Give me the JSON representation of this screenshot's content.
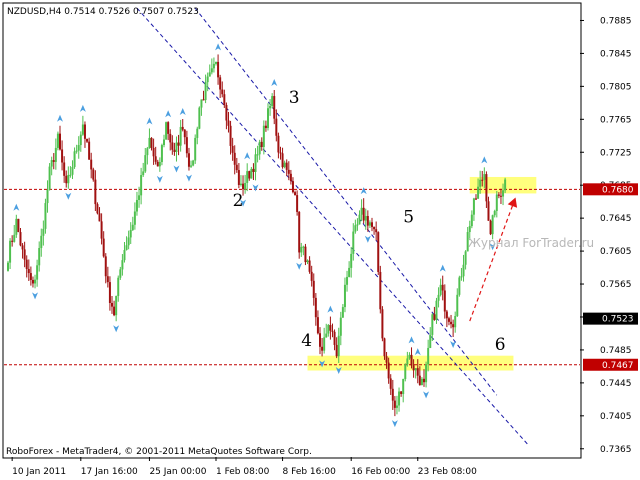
{
  "chart_data": {
    "type": "candlestick",
    "title": "NZDUSD,H4  0.7514 0.7526 0.7507 0.7523",
    "symbol": "NZDUSD,H4",
    "ohlc_readout": [
      "0.7514",
      "0.7526",
      "0.7507",
      "0.7523"
    ],
    "credit": "RoboForex - MetaTrader4, © 2001-2011 MetaQuotes Software Corp.",
    "watermark": "Журнал ForTrader.ru",
    "ylim": [
      0.7355,
      0.7905
    ],
    "y_ticks": [
      "0.7885",
      "0.7845",
      "0.7805",
      "0.7765",
      "0.7725",
      "0.7685",
      "0.7645",
      "0.7605",
      "0.7565",
      "0.7525",
      "0.7485",
      "0.7445",
      "0.7405",
      "0.7365"
    ],
    "x_ticks": [
      {
        "label": "10 Jan 2011",
        "bar": 2
      },
      {
        "label": "17 Jan 16:00",
        "bar": 35
      },
      {
        "label": "25 Jan 00:00",
        "bar": 68
      },
      {
        "label": "1 Feb 08:00",
        "bar": 100
      },
      {
        "label": "8 Feb 16:00",
        "bar": 132
      },
      {
        "label": "16 Feb 00:00",
        "bar": 165
      },
      {
        "label": "23 Feb 08:00",
        "bar": 197
      }
    ],
    "bar_count": 240,
    "anchors": [
      {
        "bar": 0,
        "price": 0.76
      },
      {
        "bar": 4,
        "price": 0.764
      },
      {
        "bar": 8,
        "price": 0.759
      },
      {
        "bar": 12,
        "price": 0.756
      },
      {
        "bar": 16,
        "price": 0.762
      },
      {
        "bar": 20,
        "price": 0.77
      },
      {
        "bar": 24,
        "price": 0.774
      },
      {
        "bar": 28,
        "price": 0.768
      },
      {
        "bar": 32,
        "price": 0.772
      },
      {
        "bar": 36,
        "price": 0.776
      },
      {
        "bar": 40,
        "price": 0.77
      },
      {
        "bar": 44,
        "price": 0.764
      },
      {
        "bar": 48,
        "price": 0.756
      },
      {
        "bar": 51,
        "price": 0.753
      },
      {
        "bar": 55,
        "price": 0.76
      },
      {
        "bar": 60,
        "price": 0.764
      },
      {
        "bar": 64,
        "price": 0.769
      },
      {
        "bar": 68,
        "price": 0.774
      },
      {
        "bar": 72,
        "price": 0.77
      },
      {
        "bar": 76,
        "price": 0.776
      },
      {
        "bar": 80,
        "price": 0.772
      },
      {
        "bar": 84,
        "price": 0.776
      },
      {
        "bar": 88,
        "price": 0.77
      },
      {
        "bar": 92,
        "price": 0.778
      },
      {
        "bar": 96,
        "price": 0.781
      },
      {
        "bar": 100,
        "price": 0.783
      },
      {
        "bar": 104,
        "price": 0.779
      },
      {
        "bar": 108,
        "price": 0.772
      },
      {
        "bar": 112,
        "price": 0.768
      },
      {
        "bar": 116,
        "price": 0.77
      },
      {
        "bar": 120,
        "price": 0.772
      },
      {
        "bar": 124,
        "price": 0.776
      },
      {
        "bar": 127,
        "price": 0.779
      },
      {
        "bar": 130,
        "price": 0.773
      },
      {
        "bar": 134,
        "price": 0.77
      },
      {
        "bar": 138,
        "price": 0.768
      },
      {
        "bar": 140,
        "price": 0.761
      },
      {
        "bar": 143,
        "price": 0.76
      },
      {
        "bar": 146,
        "price": 0.756
      },
      {
        "bar": 148,
        "price": 0.752
      },
      {
        "bar": 151,
        "price": 0.748
      },
      {
        "bar": 154,
        "price": 0.752
      },
      {
        "bar": 158,
        "price": 0.748
      },
      {
        "bar": 162,
        "price": 0.756
      },
      {
        "bar": 166,
        "price": 0.762
      },
      {
        "bar": 170,
        "price": 0.765
      },
      {
        "bar": 174,
        "price": 0.764
      },
      {
        "bar": 177,
        "price": 0.762
      },
      {
        "bar": 180,
        "price": 0.75
      },
      {
        "bar": 183,
        "price": 0.745
      },
      {
        "bar": 186,
        "price": 0.741
      },
      {
        "bar": 189,
        "price": 0.744
      },
      {
        "bar": 192,
        "price": 0.748
      },
      {
        "bar": 196,
        "price": 0.746
      },
      {
        "bar": 200,
        "price": 0.744
      },
      {
        "bar": 204,
        "price": 0.752
      },
      {
        "bar": 208,
        "price": 0.756
      },
      {
        "bar": 211,
        "price": 0.753
      },
      {
        "bar": 214,
        "price": 0.752
      },
      {
        "bar": 218,
        "price": 0.758
      },
      {
        "bar": 222,
        "price": 0.764
      },
      {
        "bar": 226,
        "price": 0.768
      },
      {
        "bar": 229,
        "price": 0.77
      },
      {
        "bar": 232,
        "price": 0.762
      },
      {
        "bar": 234,
        "price": 0.766
      },
      {
        "bar": 239,
        "price": 0.769
      }
    ],
    "bull_color": "#4fc04f",
    "bear_color": "#a01010",
    "fractal_color": "#4b9fe0",
    "horizontal_levels": [
      {
        "price": 0.768,
        "label": "0.7680",
        "color": "#c00000"
      },
      {
        "price": 0.7467,
        "label": "0.7467",
        "color": "#c00000"
      }
    ],
    "current_price": {
      "price": 0.7523,
      "label": "0.7523"
    },
    "channel_lines": [
      {
        "from": {
          "bar": 90,
          "price": 0.79
        },
        "to": {
          "bar": 235,
          "price": 0.743
        }
      },
      {
        "from": {
          "bar": 62,
          "price": 0.79
        },
        "to": {
          "bar": 250,
          "price": 0.737
        }
      }
    ],
    "target_zones": [
      {
        "bar_from": 222,
        "bar_to": 254,
        "price_from": 0.7675,
        "price_to": 0.7695
      },
      {
        "bar_from": 144,
        "bar_to": 243,
        "price_from": 0.746,
        "price_to": 0.7478
      }
    ],
    "wave_labels": [
      {
        "text": "2",
        "bar": 108,
        "price": 0.766
      },
      {
        "text": "3",
        "bar": 135,
        "price": 0.7785
      },
      {
        "text": "4",
        "bar": 141,
        "price": 0.749
      },
      {
        "text": "5",
        "bar": 190,
        "price": 0.764
      },
      {
        "text": "6",
        "bar": 234,
        "price": 0.7485
      }
    ],
    "forecast_arrow": {
      "from": {
        "bar": 222,
        "price": 0.752
      },
      "to": {
        "bar": 244,
        "price": 0.767
      }
    },
    "accent_colors": {
      "channel": "#1a1aa8",
      "level": "#c00000",
      "zone": "#ffff66",
      "arrow": "#e01515"
    }
  }
}
